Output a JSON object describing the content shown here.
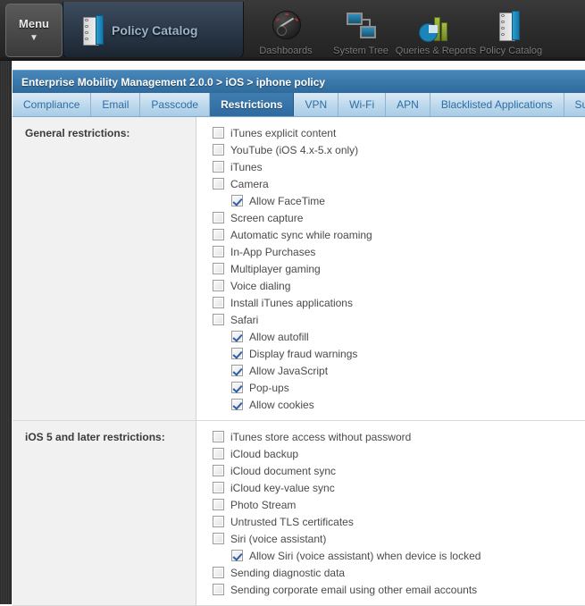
{
  "topnav": {
    "menu_button": {
      "label": "Menu",
      "caret": "▼"
    },
    "active_app": {
      "label": "Policy Catalog",
      "icon": "notebook-icon"
    },
    "items": [
      {
        "label": "Dashboards",
        "icon": "gauge-icon"
      },
      {
        "label": "System Tree",
        "icon": "tree-icon"
      },
      {
        "label": "Queries & Reports",
        "icon": "chart-pie-icon"
      },
      {
        "label": "Policy Catalog",
        "icon": "notebook-icon"
      }
    ]
  },
  "panel": {
    "breadcrumb": "Enterprise Mobility Management 2.0.0 > iOS > iphone policy",
    "tabs": [
      {
        "label": "Compliance",
        "active": false
      },
      {
        "label": "Email",
        "active": false
      },
      {
        "label": "Passcode",
        "active": false
      },
      {
        "label": "Restrictions",
        "active": true
      },
      {
        "label": "VPN",
        "active": false
      },
      {
        "label": "Wi-Fi",
        "active": false
      },
      {
        "label": "APN",
        "active": false
      },
      {
        "label": "Blacklisted Applications",
        "active": false
      },
      {
        "label": "Supervis",
        "active": false
      }
    ],
    "sections": [
      {
        "label": "General restrictions:",
        "rows": [
          {
            "label": "iTunes explicit content",
            "checked": false,
            "indent": false
          },
          {
            "label": "YouTube (iOS 4.x-5.x only)",
            "checked": false,
            "indent": false
          },
          {
            "label": "iTunes",
            "checked": false,
            "indent": false
          },
          {
            "label": "Camera",
            "checked": false,
            "indent": false
          },
          {
            "label": "Allow FaceTime",
            "checked": true,
            "indent": true
          },
          {
            "label": "Screen capture",
            "checked": false,
            "indent": false
          },
          {
            "label": "Automatic sync while roaming",
            "checked": false,
            "indent": false
          },
          {
            "label": "In-App Purchases",
            "checked": false,
            "indent": false
          },
          {
            "label": "Multiplayer gaming",
            "checked": false,
            "indent": false
          },
          {
            "label": "Voice dialing",
            "checked": false,
            "indent": false
          },
          {
            "label": "Install iTunes applications",
            "checked": false,
            "indent": false
          },
          {
            "label": "Safari",
            "checked": false,
            "indent": false
          },
          {
            "label": "Allow autofill",
            "checked": true,
            "indent": true
          },
          {
            "label": "Display fraud warnings",
            "checked": true,
            "indent": true
          },
          {
            "label": "Allow JavaScript",
            "checked": true,
            "indent": true
          },
          {
            "label": "Pop-ups",
            "checked": true,
            "indent": true
          },
          {
            "label": "Allow cookies",
            "checked": true,
            "indent": true
          }
        ]
      },
      {
        "label": "iOS 5 and later restrictions:",
        "rows": [
          {
            "label": "iTunes store access without password",
            "checked": false,
            "indent": false
          },
          {
            "label": "iCloud backup",
            "checked": false,
            "indent": false
          },
          {
            "label": "iCloud document sync",
            "checked": false,
            "indent": false
          },
          {
            "label": "iCloud key-value sync",
            "checked": false,
            "indent": false
          },
          {
            "label": "Photo Stream",
            "checked": false,
            "indent": false
          },
          {
            "label": "Untrusted TLS certificates",
            "checked": false,
            "indent": false
          },
          {
            "label": "Siri (voice assistant)",
            "checked": false,
            "indent": false
          },
          {
            "label": "Allow Siri (voice assistant) when device is locked",
            "checked": true,
            "indent": true
          },
          {
            "label": "Sending diagnostic data",
            "checked": false,
            "indent": false
          },
          {
            "label": "Sending corporate email using other email accounts",
            "checked": false,
            "indent": false
          }
        ]
      }
    ]
  },
  "colors": {
    "title_bar": "#3a78ab",
    "active_tab": "#2f6ba0",
    "tab_text": "#2e6da4",
    "checkmark": "#2c5fa8",
    "left_col_bg": "#f1f1f1",
    "nav_bg": "#2e2e2e"
  }
}
